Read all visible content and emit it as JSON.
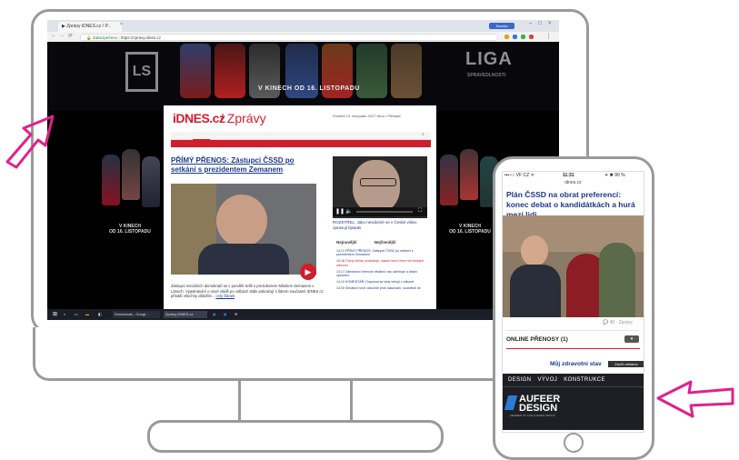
{
  "browser": {
    "tab_title": "▶ Zprávy iDNES.cz / P...",
    "tab_close": "×",
    "user_label": "Sandra",
    "url_secure": "Zabezpečeno",
    "url": "https://zpravy.idnes.cz",
    "nav_icons": [
      "←",
      "→",
      "⟳"
    ]
  },
  "banner": {
    "left_logo": "LS",
    "title_line1": "LIGA",
    "title_line2": "SPRAVEDLNOSTI",
    "tagline": "V KINECH OD 16. LISTOPADU",
    "side_left": "V KINECH\nOD 16. LISTOPADU",
    "side_right": "V KINECH\nOD 16. LISTOPADU"
  },
  "site": {
    "logo": "iDNES.cz",
    "section": "/ Zprávy",
    "date": "Pondělí 13. listopadu 2017 Nina • Přihlásit",
    "nav_primary": [
      "iDNES.cz",
      "Zprávy",
      "Kraje",
      "Sport",
      "Kultura",
      "Ekonomika",
      "Bydlení",
      "Technet",
      "Cestování",
      "Revue",
      "Auto",
      "Další"
    ],
    "nav_secondary": [
      "Domácí",
      "Zahraničí",
      "Krimi",
      "Kultura",
      "Názory",
      "Rozhovory",
      "Hlavní zprávy",
      "Prezident",
      "Speciály",
      "Volba Horáčka",
      "Počasí"
    ],
    "headline": "PŘÍMÝ PŘENOS: Zástupci ČSSD po setkání s prezidentem Zemanem",
    "perex": "Zástupci sociálních demokratů se v pondělí sešli s prezidentem Milošem Zemanem v Lánech. Vyjednávání o nové vládě po volbách stále pokračují s lídrem současné iDNES.cz přináší všechny důležité...",
    "perex_link": "celý článek",
    "video_caption": "ROZSTŘEL: Jako nevidomé se v České vídeo opravují tipwaki",
    "tabs": [
      "Nejnovější",
      "Nejčtenější"
    ],
    "news": [
      {
        "time": "14:21",
        "text": "PŘÍMÝ PŘENOS: Zástupci ČSSD po setkání s prezidentem Zemanem"
      },
      {
        "time": "14:18",
        "text": "Čtvrtý občan protestuje, zákaz řízení firem na českých silnicích"
      },
      {
        "time": "14:17",
        "text": "Zahraniční měnové dědictví vás ovlivňuje a vládní vybavení"
      },
      {
        "time": "14:10",
        "text": "KOMENTÁŘ: Doposud se tady věnují v zákoně"
      },
      {
        "time": "14:05",
        "text": "Senátoři nově zákonně proti hlasování, soustředí se"
      }
    ]
  },
  "taskbar": {
    "items": [
      "Downloads - Googl...",
      "Zprávy iDNES.cz"
    ]
  },
  "phone": {
    "carrier": "•••○○ VF CZ ᯤ",
    "time": "11:31",
    "battery": "✈ ✽ 90 %",
    "site": "idnes.cz",
    "headline": "Plán ČSSD na obrat preferencí: konec debat o kandidátkách a hurá mezi lidi",
    "comments": "💬 40 · Zprávy",
    "online_label": "ONLINE PŘENOSY (1)",
    "toggle": "▾",
    "story_teaser": "Můj zdravotní stav",
    "close_ad": "Zavřít reklamu",
    "ad_nav": [
      "DESIGN",
      "VÝVOJ",
      "KONSTRUKCE"
    ],
    "ad_logo_line1": "AUFEER",
    "ad_logo_line2": "DESIGN",
    "ad_sub": "MEMBER OF THE AUFEER GROUP"
  },
  "colors": {
    "brand_red": "#d21e2c",
    "headline_blue": "#1a3a8a",
    "arrow_pink": "#e0218a",
    "sketch_gray": "#9a9a9a"
  }
}
